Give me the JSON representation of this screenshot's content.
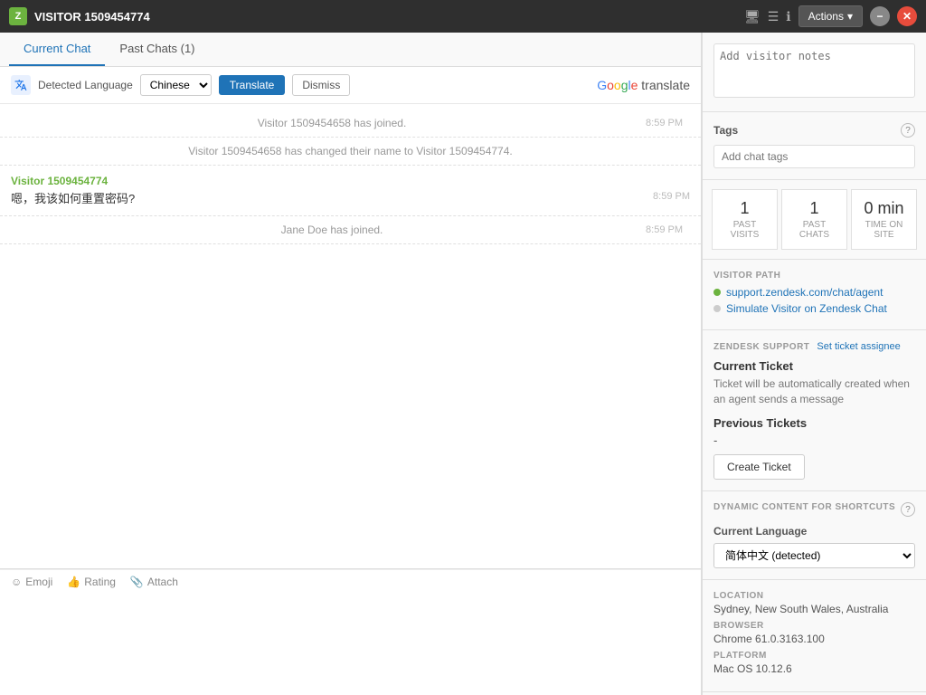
{
  "titlebar": {
    "icon_text": "Z",
    "title": "VISITOR 1509454774",
    "actions_label": "Actions",
    "actions_arrow": "▾",
    "minimize_label": "−",
    "close_label": "✕"
  },
  "tabs": {
    "current_chat": "Current Chat",
    "past_chats": "Past Chats (1)"
  },
  "translate_bar": {
    "detected_label": "Detected Language",
    "language": "Chinese",
    "translate_btn": "Translate",
    "dismiss_btn": "Dismiss",
    "google_label": "Google translate"
  },
  "messages": [
    {
      "type": "system",
      "text": "Visitor 1509454658 has joined.",
      "time": "8:59 PM"
    },
    {
      "type": "system",
      "text": "Visitor 1509454658 has changed their name to Visitor 1509454774.",
      "time": ""
    },
    {
      "type": "visitor",
      "name": "Visitor 1509454774",
      "text": "嗯，我该如何重置密码?",
      "time": "8:59 PM"
    },
    {
      "type": "system",
      "text": "Jane Doe has joined.",
      "time": "8:59 PM"
    }
  ],
  "toolbar": {
    "emoji": "Emoji",
    "rating": "Rating",
    "attach": "Attach"
  },
  "right_panel": {
    "notes": {
      "placeholder": "Add visitor notes"
    },
    "tags": {
      "label": "Tags",
      "placeholder": "Add chat tags"
    },
    "stats": [
      {
        "number": "1",
        "label": "PAST VISITS"
      },
      {
        "number": "1",
        "label": "PAST CHATS"
      },
      {
        "number": "0 min",
        "label": "TIME ON SITE"
      }
    ],
    "visitor_path": {
      "label": "VISITOR PATH",
      "items": [
        "support.zendesk.com/chat/agent",
        "Simulate Visitor on Zendesk Chat"
      ]
    },
    "zendesk_support": {
      "label": "ZENDESK SUPPORT",
      "set_assignee": "Set ticket assignee",
      "current_ticket_title": "Current Ticket",
      "current_ticket_desc": "Ticket will be automatically created when an agent sends a message",
      "previous_tickets_title": "Previous Tickets",
      "previous_tickets_val": "-",
      "create_ticket_btn": "Create Ticket"
    },
    "dynamic_content": {
      "label": "DYNAMIC CONTENT FOR SHORTCUTS",
      "current_language_label": "Current Language",
      "language_value": "简体中文 (detected)"
    },
    "location": {
      "label": "LOCATION",
      "value": "Sydney, New South Wales, Australia"
    },
    "browser": {
      "label": "BROWSER",
      "value": "Chrome 61.0.3163.100"
    },
    "platform": {
      "label": "PLATFORM",
      "value": "Mac OS 10.12.6"
    }
  }
}
